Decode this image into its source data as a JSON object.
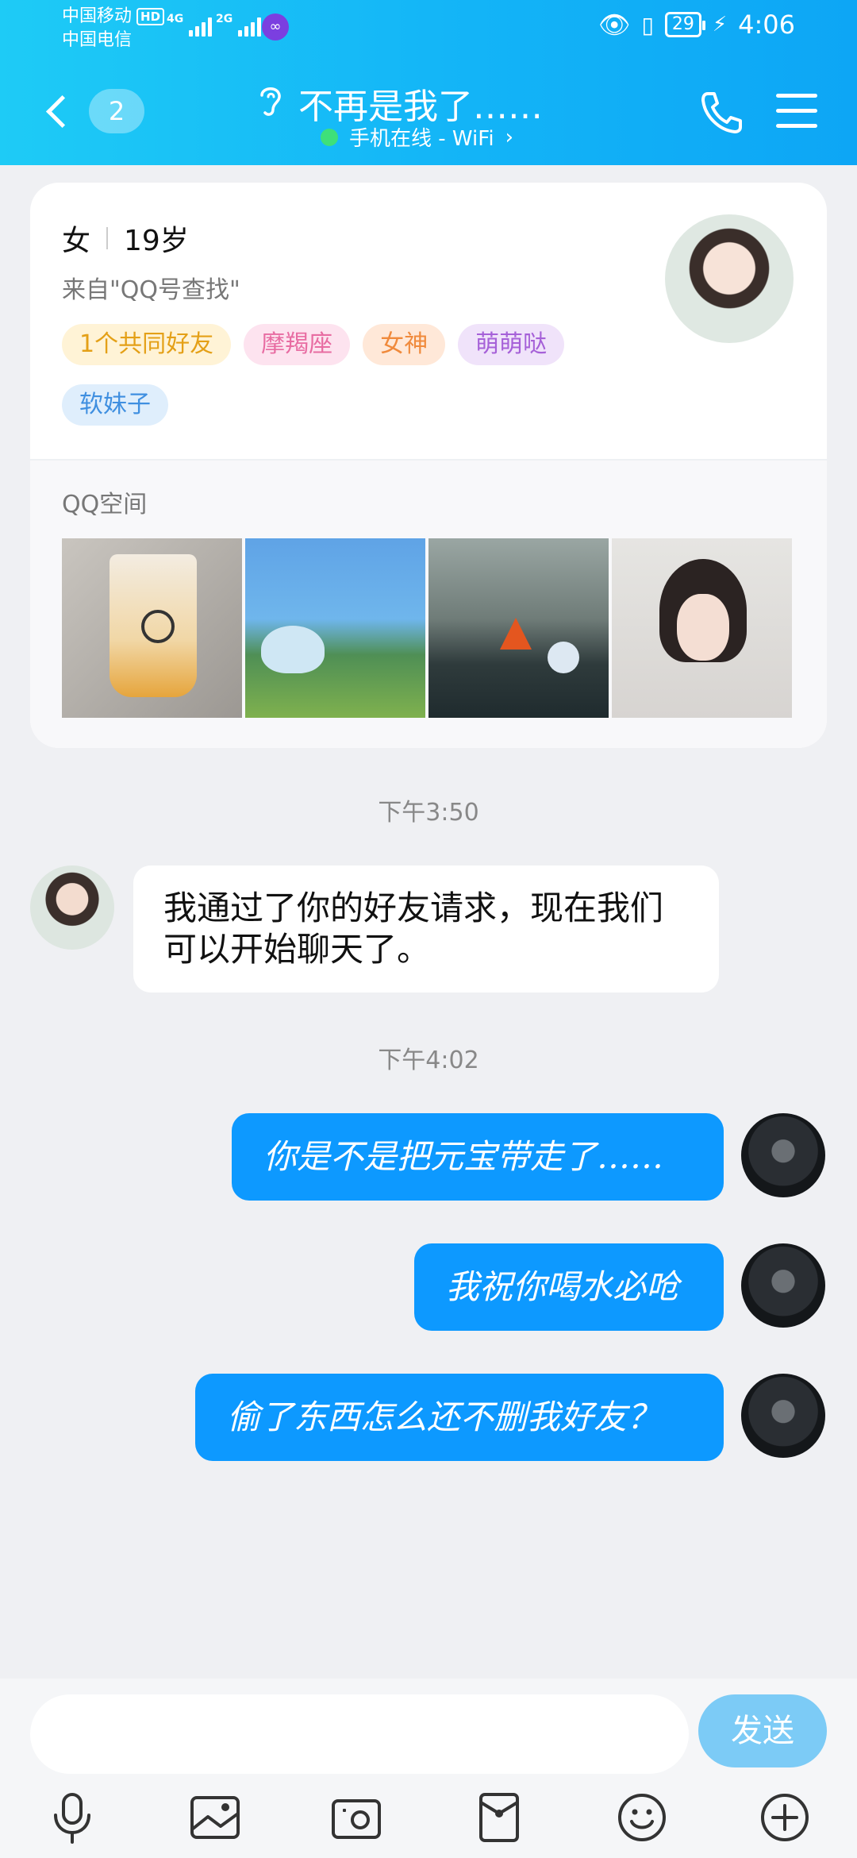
{
  "status_bar": {
    "carrier1": "中国移动",
    "carrier1_badge": "HD",
    "carrier2": "中国电信",
    "net1": "4G",
    "net2": "2G",
    "battery": "29",
    "time": "4:06"
  },
  "header": {
    "unread_count": "2",
    "title": "不再是我了……",
    "status": "手机在线 - WiFi",
    "status_chevron": "›"
  },
  "profile": {
    "gender": "女",
    "age": "19岁",
    "source": "来自\"QQ号查找\"",
    "tags": [
      "1个共同好友",
      "摩羯座",
      "女神",
      "萌萌哒",
      "软妹子"
    ],
    "qzone_label": "QQ空间"
  },
  "messages": [
    {
      "type": "time",
      "text": "下午3:50"
    },
    {
      "type": "in",
      "text": "我通过了你的好友请求，现在我们可以开始聊天了。"
    },
    {
      "type": "time",
      "text": "下午4:02"
    },
    {
      "type": "out",
      "text": "你是不是把元宝带走了……"
    },
    {
      "type": "out",
      "text": "我祝你喝水必呛"
    },
    {
      "type": "out",
      "text": "偷了东西怎么还不删我好友？"
    }
  ],
  "input": {
    "value": "",
    "send_label": "发送"
  },
  "toolbar": [
    "microphone-icon",
    "image-icon",
    "camera-icon",
    "red-packet-icon",
    "emoji-icon",
    "plus-icon"
  ],
  "colors": {
    "header_start": "#1ecbf6",
    "header_end": "#0da6f5",
    "out_bubble": "#0d99ff",
    "send_button": "#7ccbf6",
    "online_dot": "#3ee07a"
  }
}
